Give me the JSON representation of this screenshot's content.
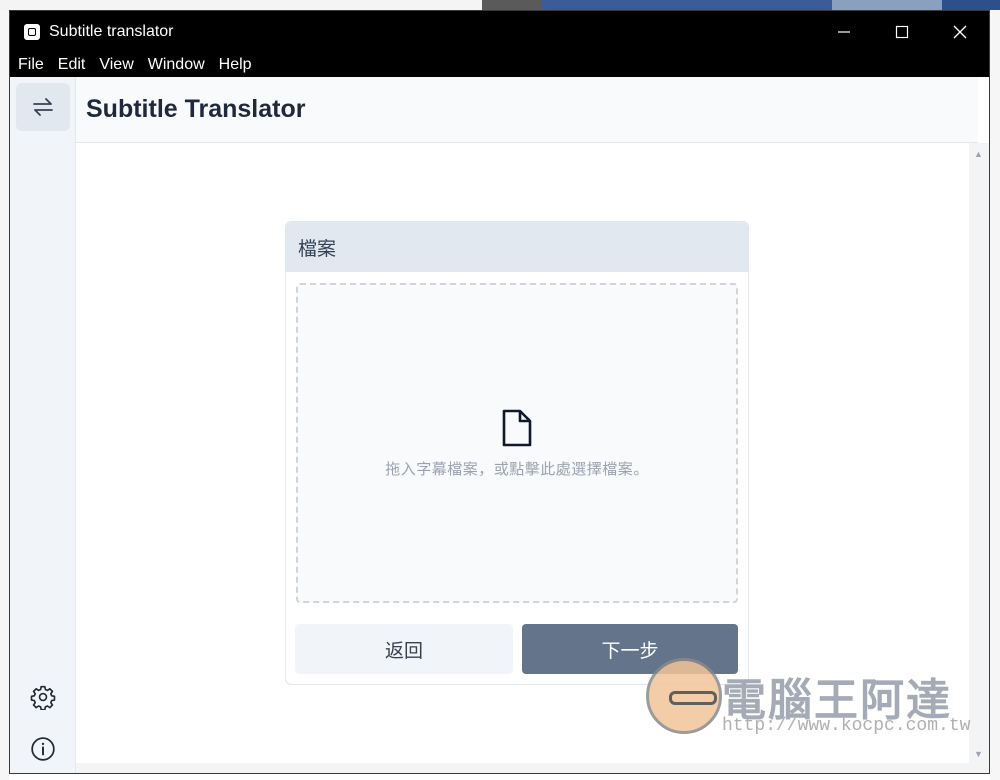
{
  "window": {
    "title": "Subtitle translator",
    "controls": {
      "minimize": "—",
      "maximize": "☐",
      "close": "✕"
    }
  },
  "menubar": {
    "items": [
      "File",
      "Edit",
      "View",
      "Window",
      "Help"
    ]
  },
  "sidebar": {
    "top_icon": "swap-arrows-icon",
    "bottom_icons": [
      "settings-gear-icon",
      "info-icon"
    ]
  },
  "header": {
    "title": "Subtitle Translator"
  },
  "card": {
    "title": "檔案",
    "dropzone_text": "拖入字幕檔案，或點擊此處選擇檔案。",
    "dropzone_icon": "file-icon",
    "back_label": "返回",
    "next_label": "下一步"
  },
  "watermark": {
    "title": "電腦王阿達",
    "url": "http://www.kocpc.com.tw"
  },
  "colors": {
    "titlebar": "#000000",
    "sidebar": "#f1f5f9",
    "card_header": "#e2e8f0",
    "next_button": "#64748b",
    "back_button": "#f1f5f9"
  }
}
